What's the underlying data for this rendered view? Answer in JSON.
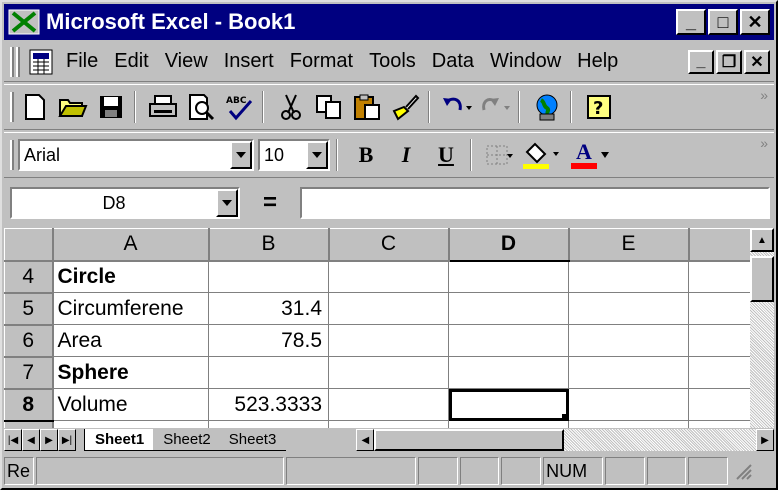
{
  "window": {
    "title": "Microsoft Excel - Book1",
    "minimize": "_",
    "maximize": "□",
    "close": "✕"
  },
  "menu": {
    "items": [
      "File",
      "Edit",
      "View",
      "Insert",
      "Format",
      "Tools",
      "Data",
      "Window",
      "Help"
    ],
    "mdi": {
      "minimize": "_",
      "restore": "❐",
      "close": "✕"
    }
  },
  "format_toolbar": {
    "font": "Arial",
    "size": "10",
    "bold": "B",
    "italic": "I",
    "underline": "U",
    "font_color_label": "A",
    "fill_color": "#ffff00",
    "font_color": "#ff0000"
  },
  "formula_bar": {
    "name_box": "D8",
    "equals": "=",
    "value": ""
  },
  "grid": {
    "columns": [
      "A",
      "B",
      "C",
      "D",
      "E"
    ],
    "active_column": "D",
    "rows": [
      {
        "num": "4",
        "a": "Circle",
        "b": "",
        "bold": true
      },
      {
        "num": "5",
        "a": "Circumferene",
        "b": "31.4",
        "bold": false
      },
      {
        "num": "6",
        "a": "Area",
        "b": "78.5",
        "bold": false
      },
      {
        "num": "7",
        "a": "Sphere",
        "b": "",
        "bold": true
      },
      {
        "num": "8",
        "a": "Volume",
        "b": "523.3333",
        "bold": false
      }
    ],
    "active_row": "8"
  },
  "sheets": {
    "tabs": [
      "Sheet1",
      "Sheet2",
      "Sheet3"
    ],
    "active": "Sheet1"
  },
  "status": {
    "mode": "Re",
    "num": "NUM"
  }
}
